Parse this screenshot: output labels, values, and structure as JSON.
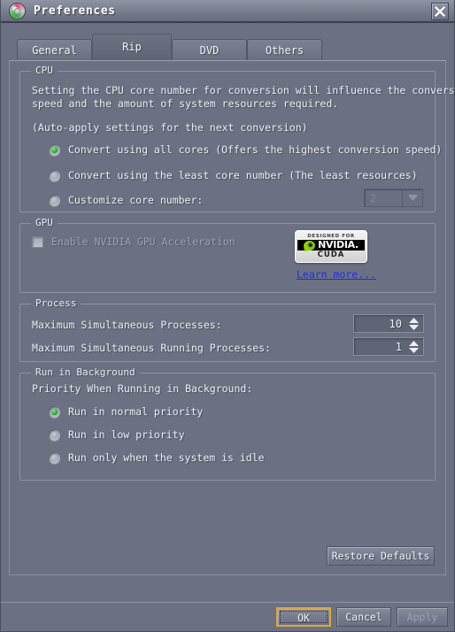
{
  "window": {
    "title": "Preferences",
    "app_icon": "disc-icon",
    "close_icon": "close-icon"
  },
  "tabs": [
    {
      "label": "General",
      "active": false
    },
    {
      "label": "Rip",
      "active": true
    },
    {
      "label": "DVD",
      "active": false
    },
    {
      "label": "Others",
      "active": false
    }
  ],
  "cpu": {
    "group_title": "CPU",
    "description_line1": "Setting the CPU core number for conversion will influence the conversion",
    "description_line2": "speed and the amount of system resources required.",
    "auto_apply_note": "(Auto-apply settings for the next conversion)",
    "options": [
      {
        "label": "Convert using all cores (Offers the highest conversion speed)",
        "selected": true
      },
      {
        "label": "Convert using the least core number (The least resources)",
        "selected": false
      },
      {
        "label": "Customize core number:",
        "selected": false
      }
    ],
    "core_count_value": "2",
    "core_count_arrow_icon": "chevron-down-icon"
  },
  "gpu": {
    "group_title": "GPU",
    "enable_label": "Enable NVIDIA GPU Acceleration",
    "enabled": false,
    "logo": {
      "top_text": "DESIGNED FOR",
      "brand_text": "NVIDIA.",
      "bottom_text": "CUDA",
      "eye_icon": "nvidia-eye-icon"
    },
    "learn_more_label": "Learn more...",
    "link_color": "#1b2df0"
  },
  "process": {
    "group_title": "Process",
    "max_simultaneous_processes_label": "Maximum Simultaneous Processes:",
    "max_simultaneous_processes_value": "10",
    "max_running_processes_label": "Maximum Simultaneous Running Processes:",
    "max_running_processes_value": "1",
    "spinner_up_icon": "triangle-up-icon",
    "spinner_down_icon": "triangle-down-icon"
  },
  "background": {
    "group_title": "Run in Background",
    "priority_label": "Priority When Running in Background:",
    "options": [
      {
        "label": "Run in normal priority",
        "selected": true
      },
      {
        "label": "Run in low priority",
        "selected": false
      },
      {
        "label": "Run only when the system is idle",
        "selected": false
      }
    ]
  },
  "buttons": {
    "restore_defaults": "Restore Defaults",
    "ok": "OK",
    "cancel": "Cancel",
    "apply": "Apply",
    "apply_enabled": false,
    "ok_focus_color": "#e0a830"
  }
}
